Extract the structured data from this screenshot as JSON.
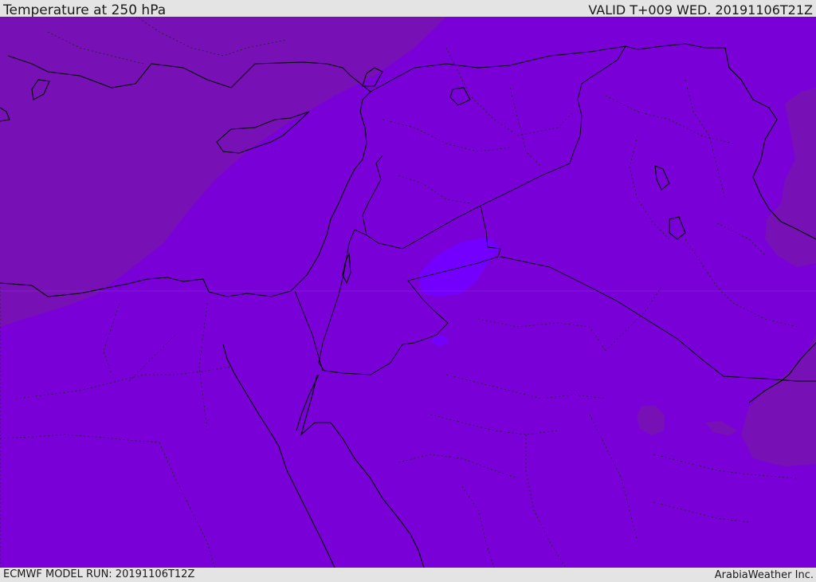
{
  "header": {
    "title": "Temperature at 250 hPa",
    "valid_time": "VALID T+009 WED. 20191106T21Z"
  },
  "footer": {
    "model_run": "ECMWF MODEL RUN: 20191106T12Z",
    "credit": "ArabiaWeather Inc."
  },
  "map": {
    "field": "temperature",
    "level": "250 hPa",
    "colors": {
      "background_band": "#7a00d8",
      "cooler_band": "#7711b6",
      "warmer_band": "#7300ff",
      "coastline": "#000000",
      "border": "#000000",
      "province": "#222222"
    }
  }
}
